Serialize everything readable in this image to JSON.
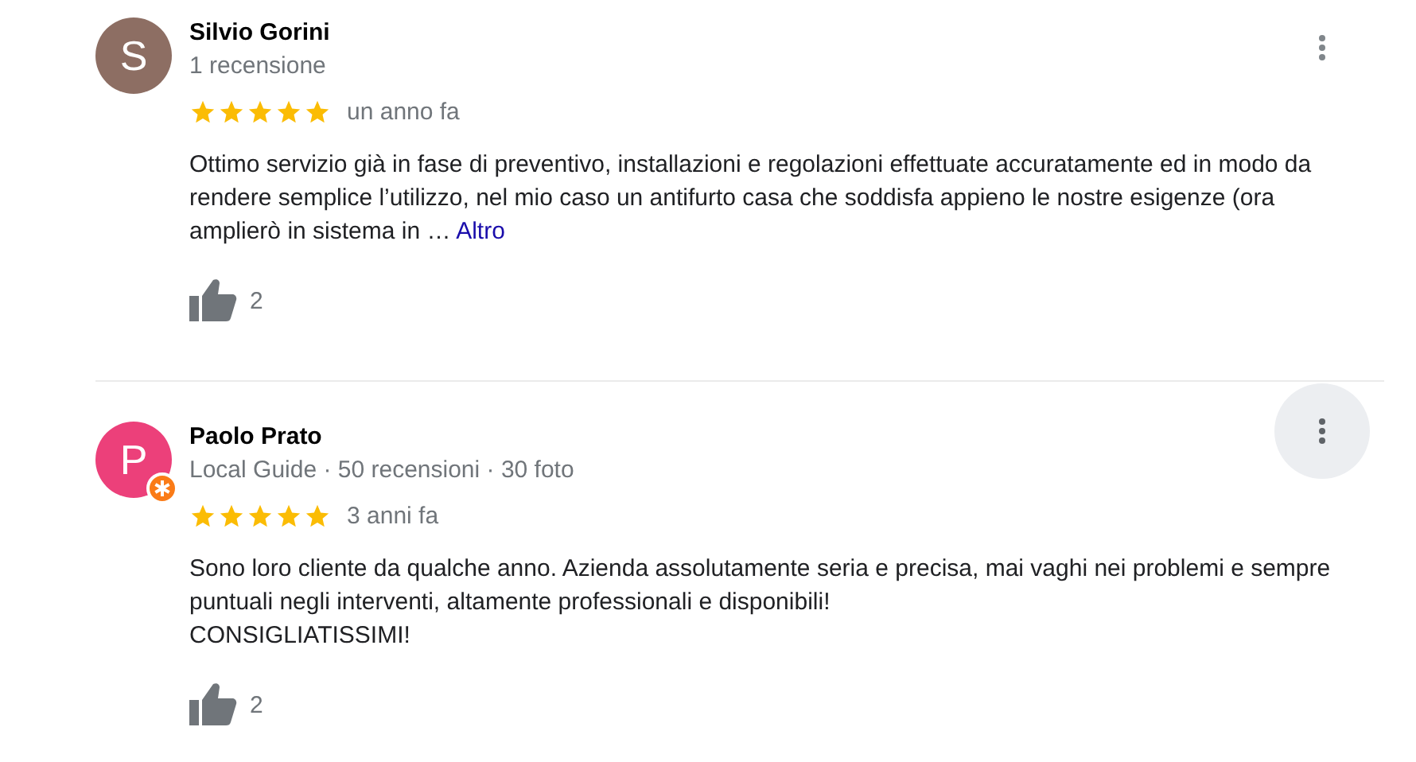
{
  "reviews": [
    {
      "initial": "S",
      "color": "#8d6e63",
      "name": "Silvio Gorini",
      "local_guide": false,
      "meta": "1 recensione",
      "stars": 5,
      "time": "un anno fa",
      "paragraphs": [
        "Ottimo servizio già in fase di preventivo, installazioni e regolazioni effettuate accuratamente ed in modo da rendere semplice l’utilizzo, nel mio caso un antifurto casa che soddisfa appieno le nostre esigenze (ora amplierò in sistema in …"
      ],
      "more_link": "Altro",
      "likes": "2",
      "menu_highlighted": false
    },
    {
      "initial": "P",
      "color": "#ec407a",
      "name": "Paolo Prato",
      "local_guide": true,
      "meta": "Local Guide · 50 recensioni · 30 foto",
      "stars": 5,
      "time": "3 anni fa",
      "paragraphs": [
        "Sono loro cliente da qualche anno. Azienda assolutamente seria e precisa, mai vaghi nei problemi e sempre puntuali negli interventi, altamente professionali e disponibili!",
        "CONSIGLIATISSIMI!"
      ],
      "likes": "2",
      "menu_highlighted": true
    }
  ]
}
